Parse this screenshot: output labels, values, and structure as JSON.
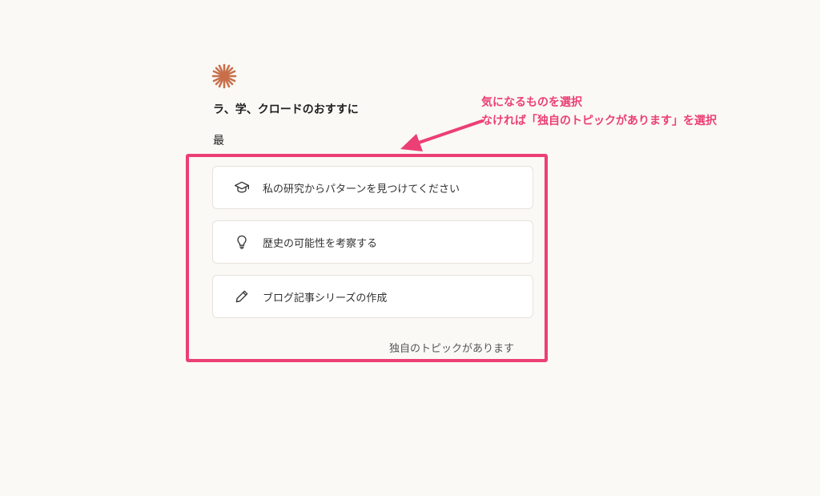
{
  "header": {
    "logo_icon": "sparkle-logo-icon",
    "logo_color": "#c86f4a",
    "intro_line": "ラ、学、クロードのおすすに",
    "intro_line_2": "最"
  },
  "annotation": {
    "line1": "気になるものを選択",
    "line2": "なければ「独自のトピックがあります」を選択",
    "color": "#ec3f74"
  },
  "options": [
    {
      "icon": "graduation-cap-icon",
      "label": "私の研究からパターンを見つけてください"
    },
    {
      "icon": "lightbulb-icon",
      "label": "歴史の可能性を考察する"
    },
    {
      "icon": "pencil-icon",
      "label": "ブログ記事シリーズの作成"
    }
  ],
  "custom_topic": {
    "label": "独自のトピックがあります"
  }
}
